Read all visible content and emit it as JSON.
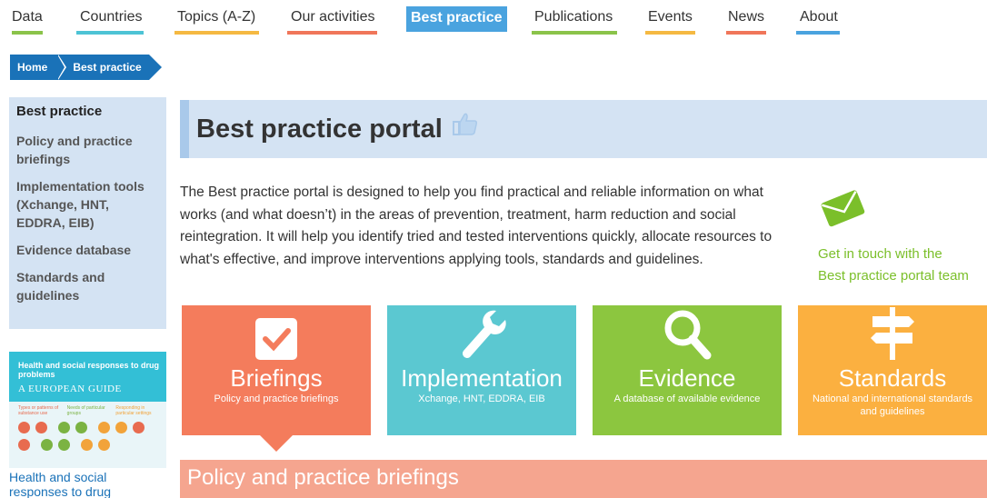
{
  "nav": {
    "items": [
      {
        "label": "Data",
        "color": "#8bc34a"
      },
      {
        "label": "Countries",
        "color": "#4dc3d5"
      },
      {
        "label": "Topics (A-Z)",
        "color": "#f5b942"
      },
      {
        "label": "Our activities",
        "color": "#f0765a"
      },
      {
        "label": "Best practice",
        "color": "#4aa3df",
        "active": true
      },
      {
        "label": "Publications",
        "color": "#8bc34a"
      },
      {
        "label": "Events",
        "color": "#f5b942"
      },
      {
        "label": "News",
        "color": "#f0765a"
      },
      {
        "label": "About",
        "color": "#4aa3df"
      }
    ]
  },
  "breadcrumb": {
    "home": "Home",
    "current": "Best practice"
  },
  "sidebar": {
    "items": [
      {
        "label": "Best practice",
        "active": true
      },
      {
        "label": "Policy and practice briefings"
      },
      {
        "label": "Implementation tools (Xchange, HNT, EDDRA, EIB)"
      },
      {
        "label": "Evidence database"
      },
      {
        "label": "Standards and guidelines"
      }
    ]
  },
  "guide": {
    "title": "Health and social responses to drug problems",
    "subtitle": "A EUROPEAN GUIDE",
    "col1": "Types or patterns of substance use",
    "col2": "Needs of particular groups",
    "col3": "Responding in particular settings",
    "link": "Health and social responses to drug"
  },
  "page": {
    "title": "Best practice portal",
    "intro": "The Best practice portal is designed to help you find practical and reliable information on what works (and what doesn’t) in the areas of prevention, treatment, harm reduction and social reintegration. It will help you identify tried and tested interventions quickly, allocate resources to what's effective, and improve interventions applying tools, standards and guidelines."
  },
  "contact": {
    "line1": "Get in touch with the",
    "line2": "Best practice portal team",
    "icon": "envelope-icon",
    "color": "#7bbf2a"
  },
  "tiles": [
    {
      "name": "Briefings",
      "desc": "Policy and practice briefings",
      "icon": "checkbox-icon",
      "color": "#f47c5c"
    },
    {
      "name": "Implementation",
      "desc": "Xchange, HNT, EDDRA, EIB",
      "icon": "wrench-icon",
      "color": "#5bc8d1"
    },
    {
      "name": "Evidence",
      "desc": "A database of available evidence",
      "icon": "magnifier-icon",
      "color": "#8cc63f"
    },
    {
      "name": "Standards",
      "desc": "National and international standards and guidelines",
      "icon": "signpost-icon",
      "color": "#fbb040"
    }
  ],
  "section": {
    "title": "Policy and practice briefings"
  }
}
